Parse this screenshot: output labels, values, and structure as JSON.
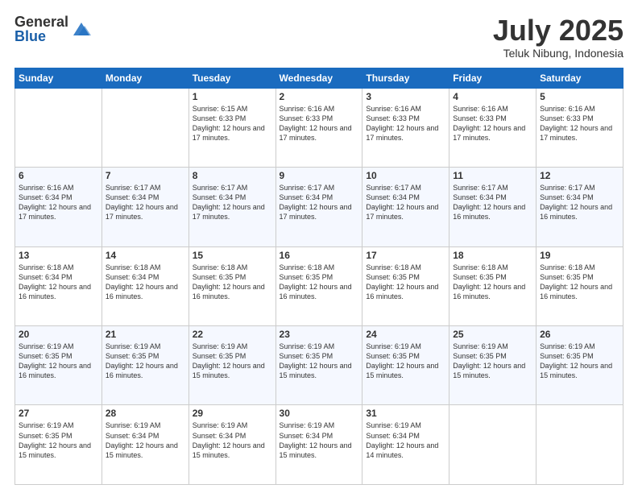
{
  "logo": {
    "general": "General",
    "blue": "Blue"
  },
  "header": {
    "month": "July 2025",
    "location": "Teluk Nibung, Indonesia"
  },
  "weekdays": [
    "Sunday",
    "Monday",
    "Tuesday",
    "Wednesday",
    "Thursday",
    "Friday",
    "Saturday"
  ],
  "weeks": [
    [
      {
        "day": "",
        "info": ""
      },
      {
        "day": "",
        "info": ""
      },
      {
        "day": "1",
        "info": "Sunrise: 6:15 AM\nSunset: 6:33 PM\nDaylight: 12 hours and 17 minutes."
      },
      {
        "day": "2",
        "info": "Sunrise: 6:16 AM\nSunset: 6:33 PM\nDaylight: 12 hours and 17 minutes."
      },
      {
        "day": "3",
        "info": "Sunrise: 6:16 AM\nSunset: 6:33 PM\nDaylight: 12 hours and 17 minutes."
      },
      {
        "day": "4",
        "info": "Sunrise: 6:16 AM\nSunset: 6:33 PM\nDaylight: 12 hours and 17 minutes."
      },
      {
        "day": "5",
        "info": "Sunrise: 6:16 AM\nSunset: 6:33 PM\nDaylight: 12 hours and 17 minutes."
      }
    ],
    [
      {
        "day": "6",
        "info": "Sunrise: 6:16 AM\nSunset: 6:34 PM\nDaylight: 12 hours and 17 minutes."
      },
      {
        "day": "7",
        "info": "Sunrise: 6:17 AM\nSunset: 6:34 PM\nDaylight: 12 hours and 17 minutes."
      },
      {
        "day": "8",
        "info": "Sunrise: 6:17 AM\nSunset: 6:34 PM\nDaylight: 12 hours and 17 minutes."
      },
      {
        "day": "9",
        "info": "Sunrise: 6:17 AM\nSunset: 6:34 PM\nDaylight: 12 hours and 17 minutes."
      },
      {
        "day": "10",
        "info": "Sunrise: 6:17 AM\nSunset: 6:34 PM\nDaylight: 12 hours and 17 minutes."
      },
      {
        "day": "11",
        "info": "Sunrise: 6:17 AM\nSunset: 6:34 PM\nDaylight: 12 hours and 16 minutes."
      },
      {
        "day": "12",
        "info": "Sunrise: 6:17 AM\nSunset: 6:34 PM\nDaylight: 12 hours and 16 minutes."
      }
    ],
    [
      {
        "day": "13",
        "info": "Sunrise: 6:18 AM\nSunset: 6:34 PM\nDaylight: 12 hours and 16 minutes."
      },
      {
        "day": "14",
        "info": "Sunrise: 6:18 AM\nSunset: 6:34 PM\nDaylight: 12 hours and 16 minutes."
      },
      {
        "day": "15",
        "info": "Sunrise: 6:18 AM\nSunset: 6:35 PM\nDaylight: 12 hours and 16 minutes."
      },
      {
        "day": "16",
        "info": "Sunrise: 6:18 AM\nSunset: 6:35 PM\nDaylight: 12 hours and 16 minutes."
      },
      {
        "day": "17",
        "info": "Sunrise: 6:18 AM\nSunset: 6:35 PM\nDaylight: 12 hours and 16 minutes."
      },
      {
        "day": "18",
        "info": "Sunrise: 6:18 AM\nSunset: 6:35 PM\nDaylight: 12 hours and 16 minutes."
      },
      {
        "day": "19",
        "info": "Sunrise: 6:18 AM\nSunset: 6:35 PM\nDaylight: 12 hours and 16 minutes."
      }
    ],
    [
      {
        "day": "20",
        "info": "Sunrise: 6:19 AM\nSunset: 6:35 PM\nDaylight: 12 hours and 16 minutes."
      },
      {
        "day": "21",
        "info": "Sunrise: 6:19 AM\nSunset: 6:35 PM\nDaylight: 12 hours and 16 minutes."
      },
      {
        "day": "22",
        "info": "Sunrise: 6:19 AM\nSunset: 6:35 PM\nDaylight: 12 hours and 15 minutes."
      },
      {
        "day": "23",
        "info": "Sunrise: 6:19 AM\nSunset: 6:35 PM\nDaylight: 12 hours and 15 minutes."
      },
      {
        "day": "24",
        "info": "Sunrise: 6:19 AM\nSunset: 6:35 PM\nDaylight: 12 hours and 15 minutes."
      },
      {
        "day": "25",
        "info": "Sunrise: 6:19 AM\nSunset: 6:35 PM\nDaylight: 12 hours and 15 minutes."
      },
      {
        "day": "26",
        "info": "Sunrise: 6:19 AM\nSunset: 6:35 PM\nDaylight: 12 hours and 15 minutes."
      }
    ],
    [
      {
        "day": "27",
        "info": "Sunrise: 6:19 AM\nSunset: 6:35 PM\nDaylight: 12 hours and 15 minutes."
      },
      {
        "day": "28",
        "info": "Sunrise: 6:19 AM\nSunset: 6:34 PM\nDaylight: 12 hours and 15 minutes."
      },
      {
        "day": "29",
        "info": "Sunrise: 6:19 AM\nSunset: 6:34 PM\nDaylight: 12 hours and 15 minutes."
      },
      {
        "day": "30",
        "info": "Sunrise: 6:19 AM\nSunset: 6:34 PM\nDaylight: 12 hours and 15 minutes."
      },
      {
        "day": "31",
        "info": "Sunrise: 6:19 AM\nSunset: 6:34 PM\nDaylight: 12 hours and 14 minutes."
      },
      {
        "day": "",
        "info": ""
      },
      {
        "day": "",
        "info": ""
      }
    ]
  ]
}
